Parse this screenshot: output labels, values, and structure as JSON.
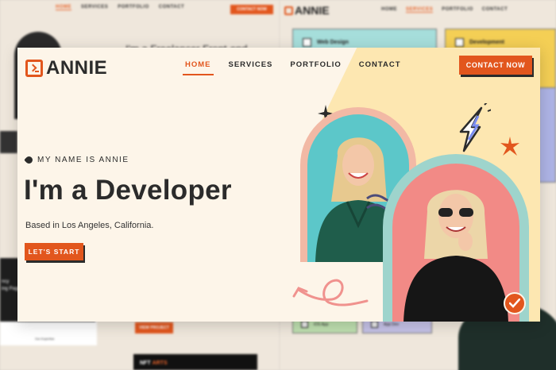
{
  "background_left": {
    "nav": [
      "HOME",
      "SERVICES",
      "PORTFOLIO",
      "CONTACT"
    ],
    "cta": "CONTACT NOW",
    "headline": "I'm a Freelancer Front-end",
    "dark_card_text": "ncy\ning Page",
    "card_text": "Our Expertise",
    "view_button": "VIEW PROJECT",
    "nft_word1": "NFT",
    "nft_word2": "ARTS"
  },
  "background_right": {
    "logo": "ANNIE",
    "nav": [
      "HOME",
      "SERVICES",
      "PORTFOLIO",
      "CONTACT"
    ],
    "cards": [
      "Web Design",
      "Development",
      "iOS App",
      "App Dev"
    ]
  },
  "hero": {
    "brand": "ANNIE",
    "menu": [
      {
        "label": "HOME",
        "active": true
      },
      {
        "label": "SERVICES",
        "active": false
      },
      {
        "label": "PORTFOLIO",
        "active": false
      },
      {
        "label": "CONTACT",
        "active": false
      }
    ],
    "contact_button": "CONTACT NOW",
    "eyebrow": "MY NAME IS ANNIE",
    "title": "I'm a Developer",
    "subtitle": "Based in Los Angeles, California.",
    "start_button": "LET'S START"
  },
  "colors": {
    "accent": "#e2561d",
    "hero_bg": "#fdf5e9",
    "yellow_shape": "#fde7b1",
    "teal": "#5cc7c9",
    "peach": "#f2b9a5",
    "pink": "#f28a86",
    "mint": "#9ed4cc",
    "ink": "#2b2b2b"
  }
}
